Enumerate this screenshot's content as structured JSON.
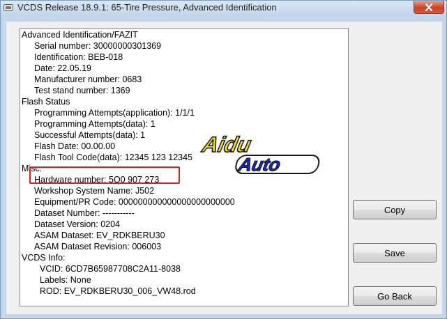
{
  "window": {
    "title": "VCDS Release 18.9.1: 65-Tire Pressure,  Advanced Identification"
  },
  "info_lines": [
    "Advanced Identification/FAZIT",
    "Serial number: 30000000301369",
    "Identification: BEB-018",
    "Date: 22.05.19",
    "Manufacturer number: 0683",
    "Test stand number: 1369",
    "Flash Status",
    "Programming Attempts(application): 1/1/1",
    "Programming Attempts(data): 1",
    "Successful Attempts(data): 1",
    "Flash Date: 00.00.00",
    "Flash Tool Code(data): 12345 123 12345",
    "Misc.",
    "Hardware number: 5Q0 907 273",
    "Workshop System Name: J502",
    "Equipment/PR Code: 000000000000000000000000",
    "Dataset Number: -----------",
    "Dataset Version: 0204",
    "ASAM Dataset: EV_RDKBERU30",
    "ASAM Dataset Revision: 006003",
    "VCDS Info:",
    "VCID: 6CD7B65987708C2A11-8038",
    "Labels: None",
    "ROD: EV_RDKBERU30_006_VW48.rod"
  ],
  "buttons": {
    "copy": "Copy",
    "save": "Save",
    "go_back": "Go Back"
  },
  "watermark": {
    "line1": "Aidu",
    "line2": "Auto"
  },
  "icons": {
    "app": "vcds-app-icon",
    "close": "close-icon"
  }
}
